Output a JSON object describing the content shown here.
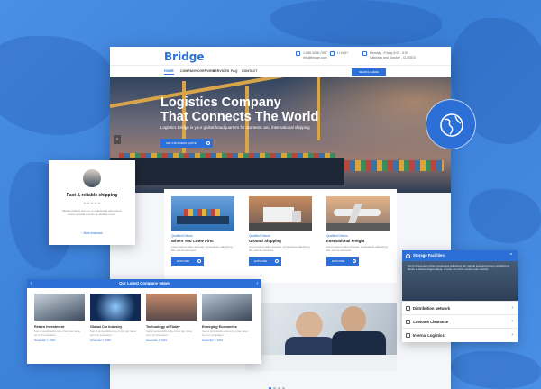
{
  "brand": {
    "name": "Bridge",
    "accent": "#2c6fd6",
    "background": "#3f86e0"
  },
  "contacts": [
    {
      "icon": "phone-icon",
      "line1": "1-888-3436-7957",
      "line2": "info@bridge.com"
    },
    {
      "icon": "social-icon",
      "line1": "f  t  in  G+",
      "line2": ""
    },
    {
      "icon": "mail-icon",
      "line1": "Monday - Friday 8:00 - 5:00",
      "line2": "Saturday and Sunday - CLOSED"
    }
  ],
  "nav": {
    "items": [
      "HOME",
      "COMPANY OVERVIEW",
      "SERVICES",
      "FAQ",
      "CONTACT"
    ],
    "active": "HOME",
    "search_label": "SEARCH HERE"
  },
  "hero": {
    "title_line1": "Logistics Company",
    "title_line2": "That Connects The World",
    "subtitle": "Logistics Bridge is your global headquarters for domestic and international shipping",
    "button_label": "GET A BUSINESS QUOTE"
  },
  "services": [
    {
      "category": "Qualified Drivers",
      "title": "Where You Come First",
      "text": "Lorem ipsum dolor sit amet, consectetur adipiscing elit, sed do eiusmod.",
      "button": "EXPLORE",
      "icon": "cargo-ship-image"
    },
    {
      "category": "Qualified Drivers",
      "title": "Ground Shipping",
      "text": "Lorem ipsum dolor sit amet, consectetur adipiscing elit, sed do eiusmod.",
      "button": "EXPLORE",
      "icon": "truck-image"
    },
    {
      "category": "Qualified Drivers",
      "title": "International Freight",
      "text": "Lorem ipsum dolor sit amet, consectetur adipiscing elit, sed do eiusmod.",
      "button": "EXPLORE",
      "icon": "airplane-image"
    }
  ],
  "testimonial": {
    "title": "Fast & reliable shipping",
    "stars": "★★★★★",
    "text": "Aliquam finibus elit non, in malesuada odio ipsum. Fusce gravida et enim ac facilisis ut est.",
    "author": "~ Mark Anderson"
  },
  "news": {
    "title": "Our Latest Company News",
    "items": [
      {
        "title": "Return Investment",
        "text": "Sed ut perspiciatis unde omnis iste natus error sit voluptatem.",
        "date": "November 7, 2016"
      },
      {
        "title": "Global Car Industry",
        "text": "Sed ut perspiciatis unde omnis iste natus error sit voluptatem.",
        "date": "November 7, 2016"
      },
      {
        "title": "Technology of Today",
        "text": "Sed ut perspiciatis unde omnis iste natus error sit voluptatem.",
        "date": "November 7, 2016"
      },
      {
        "title": "Emerging Economies",
        "text": "Sed ut perspiciatis unde omnis iste natus error sit voluptatem.",
        "date": "November 7, 2016"
      }
    ]
  },
  "accordion": {
    "open_title": "Storage Facilities",
    "open_text": "Tep In Preventure Infom consectetur adipiscing elit, sed do eiusmod tempor incididunt ut labore et dolore magna aliqua. Ut enim ad minim veniam quis nostrud.",
    "rows": [
      "Distribution Network",
      "Customs Clearance",
      "Internal Logistics"
    ]
  },
  "slider": {
    "pages": 4,
    "active_page": 1
  }
}
